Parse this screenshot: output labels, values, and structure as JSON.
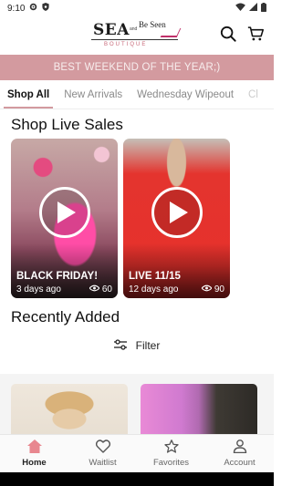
{
  "status_bar": {
    "time": "9:10"
  },
  "header": {
    "logo": {
      "main": "SEA",
      "and": "and",
      "beseen": "Be Seen",
      "sub": "BOUTIQUE"
    }
  },
  "banner": {
    "text": "BEST WEEKEND OF THE YEAR;)"
  },
  "tabs": [
    {
      "label": "Shop All",
      "active": true
    },
    {
      "label": "New Arrivals",
      "active": false
    },
    {
      "label": "Wednesday Wipeout",
      "active": false
    },
    {
      "label": "Cl",
      "active": false
    }
  ],
  "live_sales": {
    "title": "Shop Live Sales",
    "cards": [
      {
        "label": "BLACK FRIDAY!",
        "age": "3 days ago",
        "views": "60"
      },
      {
        "label": "LIVE 11/15",
        "age": "12 days ago",
        "views": "90"
      }
    ]
  },
  "recent": {
    "title": "Recently Added",
    "filter_label": "Filter"
  },
  "bottom_nav": [
    {
      "label": "Home",
      "icon": "home-icon",
      "active": true
    },
    {
      "label": "Waitlist",
      "icon": "heart-icon",
      "active": false
    },
    {
      "label": "Favorites",
      "icon": "star-icon",
      "active": false
    },
    {
      "label": "Account",
      "icon": "person-icon",
      "active": false
    }
  ],
  "colors": {
    "accent": "#d39a9f",
    "home_active": "#e8878f"
  }
}
